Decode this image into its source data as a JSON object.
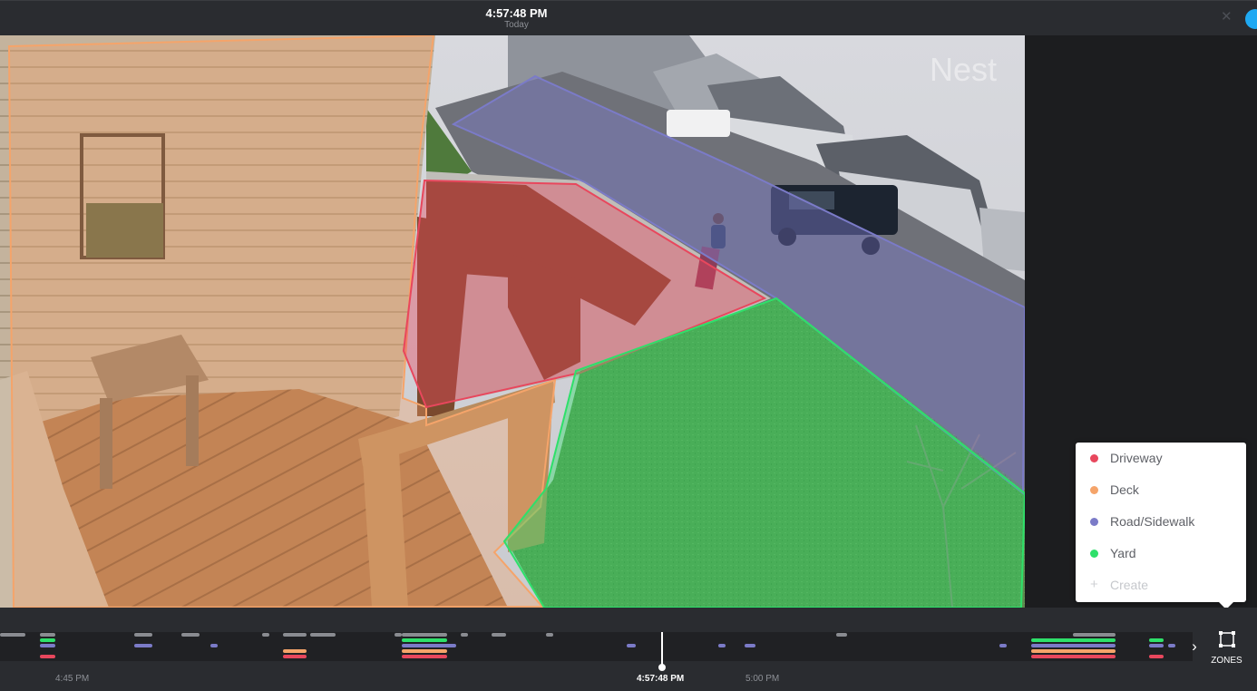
{
  "header": {
    "time": "4:57:48 PM",
    "day": "Today"
  },
  "video": {
    "watermark": "Nest"
  },
  "zones": {
    "items": [
      {
        "label": "Driveway",
        "color": "#e8475d"
      },
      {
        "label": "Deck",
        "color": "#f5a46a"
      },
      {
        "label": "Road/Sidewalk",
        "color": "#7b7bc8"
      },
      {
        "label": "Yard",
        "color": "#2ee06a"
      }
    ],
    "create_label": "Create",
    "button_label": "ZONES"
  },
  "timeline": {
    "labels": [
      "4:45 PM",
      "4:57:48 PM",
      "5:00 PM"
    ],
    "current": "4:57:48 PM",
    "colors": {
      "motion": "#8a8c91",
      "yard": "#2ee06a",
      "road": "#7b7bc8",
      "deck": "#f5a46a",
      "driveway": "#e8475d"
    }
  }
}
